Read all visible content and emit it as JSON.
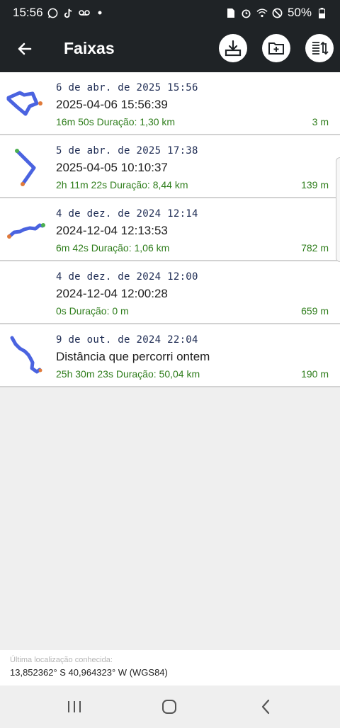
{
  "status_bar": {
    "time": "15:56",
    "battery": "50%",
    "icons": [
      "whatsapp-icon",
      "tiktok-icon",
      "voicemail-icon",
      "dot-icon",
      "sim-icon",
      "alarm-icon",
      "wifi-icon",
      "dnd-icon",
      "battery-icon"
    ]
  },
  "app_bar": {
    "title": "Faixas",
    "actions": [
      "import-icon",
      "new-folder-icon",
      "sort-icon"
    ]
  },
  "tracks": [
    {
      "date": "6 de abr. de 2025 15:56",
      "name": "2025-04-06 15:56:39",
      "duration": "16m 50s  Duração: 1,30 km",
      "distance": "3 m"
    },
    {
      "date": "5 de abr. de 2025 17:38",
      "name": "2025-04-05 10:10:37",
      "duration": "2h 11m 22s  Duração: 8,44 km",
      "distance": "139 m"
    },
    {
      "date": "4 de dez. de 2024 12:14",
      "name": "2024-12-04 12:13:53",
      "duration": "6m 42s  Duração: 1,06 km",
      "distance": "782 m"
    },
    {
      "date": "4 de dez. de 2024 12:00",
      "name": "2024-12-04 12:00:28",
      "duration": "0s  Duração: 0 m",
      "distance": "659 m"
    },
    {
      "date": "9 de out. de 2024 22:04",
      "name": "Distância que percorri ontem",
      "duration": "25h 30m 23s  Duração: 50,04 km",
      "distance": "190 m"
    }
  ],
  "footer": {
    "label": "Última localização conhecida:",
    "value": "13,852362° S 40,964323° W (WGS84)"
  },
  "colors": {
    "app_bar": "#1f2326",
    "track_line": "#4a63e0",
    "start_point": "#4caf50",
    "end_point": "#e07a3a",
    "accent_text": "#2e7d1b"
  }
}
